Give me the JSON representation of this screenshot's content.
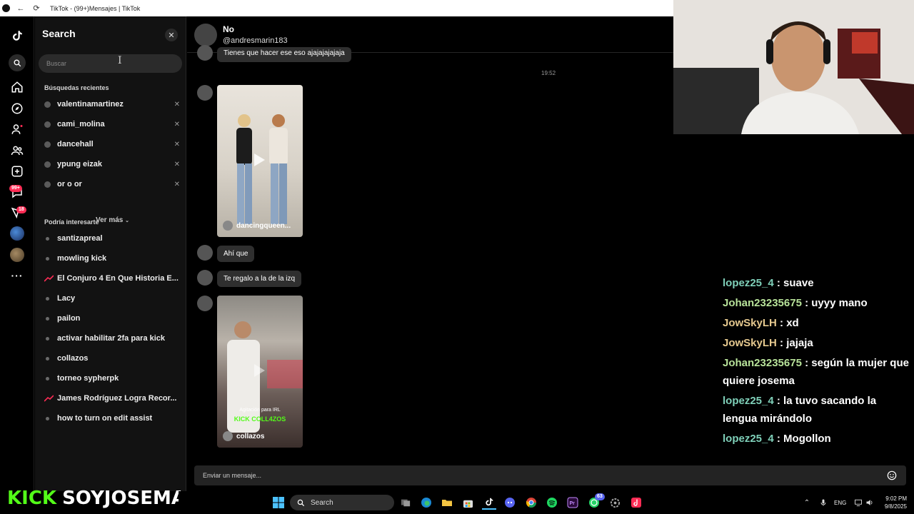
{
  "browser": {
    "title": "TikTok - (99+)Mensajes | TikTok"
  },
  "rail": {
    "badges": {
      "messages": "99+",
      "activity": "18"
    }
  },
  "search_panel": {
    "title": "Search",
    "placeholder": "Buscar",
    "recent_heading": "Búsquedas recientes",
    "recent": [
      {
        "label": "valentinamartinez"
      },
      {
        "label": "cami_molina"
      },
      {
        "label": "dancehall"
      },
      {
        "label": "ypung eizak"
      },
      {
        "label": "or o or"
      }
    ],
    "more_label": "Ver más",
    "suggest_heading": "Podría interesarte",
    "suggestions": [
      {
        "label": "santizapreal",
        "trending": false
      },
      {
        "label": "mowling kick",
        "trending": false
      },
      {
        "label": "El Conjuro 4 En Que Historia E...",
        "trending": true
      },
      {
        "label": "Lacy",
        "trending": false
      },
      {
        "label": "pailon",
        "trending": false
      },
      {
        "label": "activar habilitar 2fa para kick",
        "trending": false
      },
      {
        "label": "collazos",
        "trending": false
      },
      {
        "label": "torneo sypherpk",
        "trending": false
      },
      {
        "label": "James Rodríguez Logra Recor...",
        "trending": true
      },
      {
        "label": "how to turn on edit assist",
        "trending": false
      }
    ]
  },
  "chat": {
    "name": "No",
    "handle": "@andresmarin183",
    "partial_message": "Tienes que hacer ese eso ajajajajajaja",
    "timestamp": "19:52",
    "video1_author": "dancingqueen...",
    "message1": "Ahí que",
    "message2": "Te regalo a la de la izq",
    "video2_caption_top": "Agitación para IRL",
    "video2_caption_brand": "KICK COLL4ZOS",
    "video2_author": "collazos",
    "composer_placeholder": "Enviar un mensaje..."
  },
  "stream_chat": [
    {
      "user": "lopez25_4",
      "color": "#7fd0b9",
      "text": ": suave"
    },
    {
      "user": "Johan23235675",
      "color": "#b8e39a",
      "text": ": uyyy mano"
    },
    {
      "user": "JowSkyLH",
      "color": "#e6c98f",
      "text": ": xd"
    },
    {
      "user": "JowSkyLH",
      "color": "#e6c98f",
      "text": ": jajaja"
    },
    {
      "user": "Johan23235675",
      "color": "#b8e39a",
      "text": ": según la mujer que quiere josema"
    },
    {
      "user": "lopez25_4",
      "color": "#7fd0b9",
      "text": ": la tuvo sacando la lengua mirándolo"
    },
    {
      "user": "lopez25_4",
      "color": "#7fd0b9",
      "text": ": Mogollon"
    }
  ],
  "stream_logo": {
    "brand": "KICK",
    "channel": "SOYJOSEMA"
  },
  "taskbar": {
    "search_label": "Search",
    "lang": "ENG",
    "time": "9:02 PM",
    "date": "9/8/2025",
    "discord_badge": "63"
  }
}
